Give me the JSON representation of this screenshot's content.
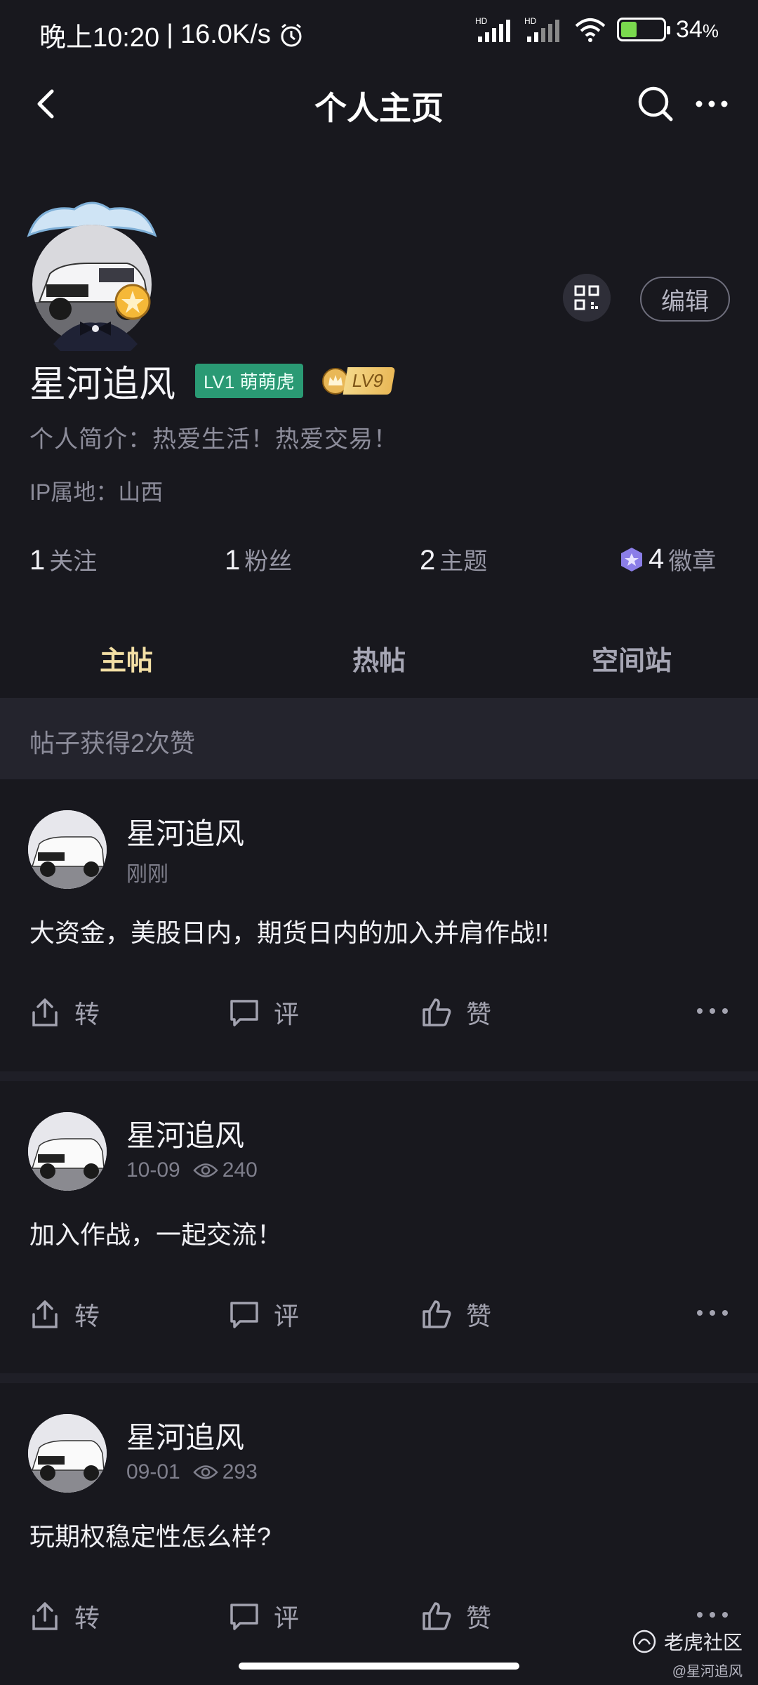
{
  "status": {
    "time": "晚上10:20",
    "speed": "16.0K/s",
    "signal1_label": "HD",
    "signal2_label": "HD",
    "battery_pct": "34",
    "battery_unit": "%"
  },
  "nav": {
    "title": "个人主页"
  },
  "profile": {
    "name": "星河追风",
    "level_badge": "LV1 萌萌虎",
    "vip_badge": "LV9",
    "edit_label": "编辑",
    "bio": "个人简介：热爱生活！热爱交易！",
    "ip": "IP属地：山西",
    "stats": [
      {
        "num": "1",
        "label": "关注"
      },
      {
        "num": "1",
        "label": "粉丝"
      },
      {
        "num": "2",
        "label": "主题"
      },
      {
        "num": "4",
        "label": "徽章"
      }
    ]
  },
  "tabs": [
    {
      "label": "主帖",
      "active": true
    },
    {
      "label": "热帖",
      "active": false
    },
    {
      "label": "空间站",
      "active": false
    }
  ],
  "likes_banner": "帖子获得2次赞",
  "posts": [
    {
      "author": "星河追风",
      "time": "刚刚",
      "views": "",
      "content": "大资金，美股日内，期货日内的加入并肩作战!!"
    },
    {
      "author": "星河追风",
      "time": "10-09",
      "views": "240",
      "content": "加入作战，一起交流！"
    },
    {
      "author": "星河追风",
      "time": "09-01",
      "views": "293",
      "content": "玩期权稳定性怎么样?"
    }
  ],
  "actions": {
    "share": "转",
    "comment": "评",
    "like": "赞"
  },
  "watermark": {
    "brand": "老虎社区",
    "user": "@星河追风"
  },
  "colors": {
    "background": "#18181e",
    "accent_tab": "#f3dfa5",
    "level_green": "#2a9a74",
    "vip_gold": "#e9b857"
  }
}
